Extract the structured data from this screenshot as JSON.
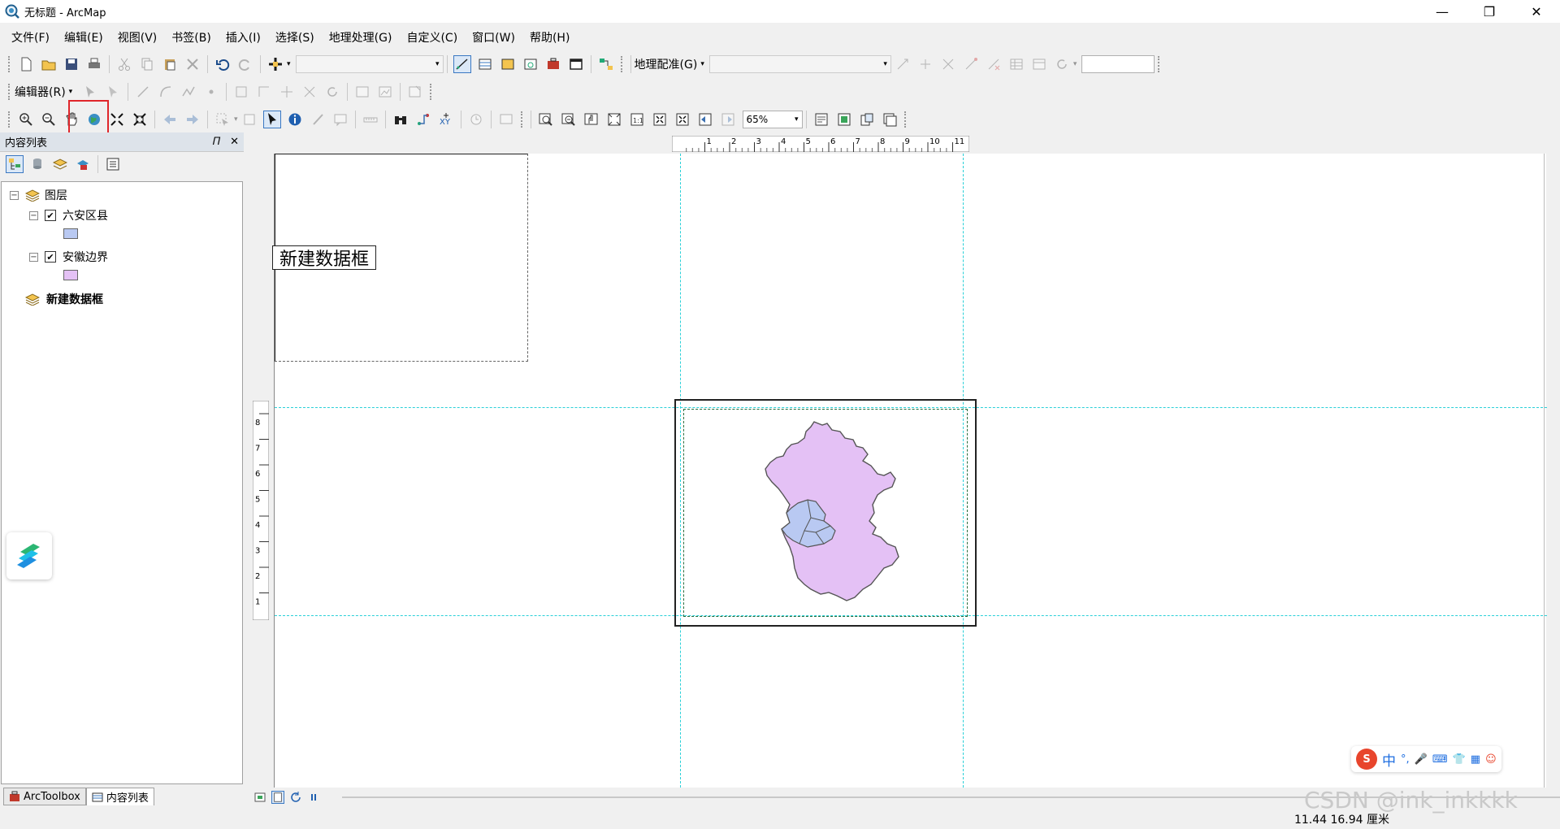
{
  "window": {
    "title": "无标题 - ArcMap",
    "controls": [
      "minimize",
      "restore",
      "close"
    ]
  },
  "menu": {
    "items": [
      "文件(F)",
      "编辑(E)",
      "视图(V)",
      "书签(B)",
      "插入(I)",
      "选择(S)",
      "地理处理(G)",
      "自定义(C)",
      "窗口(W)",
      "帮助(H)"
    ]
  },
  "toolbar1": {
    "georef_label": "地理配准(G)"
  },
  "toolbar2": {
    "editor_label": "编辑器(R)"
  },
  "toolbar3": {
    "zoom_value": "65%"
  },
  "toc": {
    "title": "内容列表",
    "root_layer_group": "图层",
    "layers": [
      {
        "name": "六安区县",
        "checked": true,
        "swatch_color": "#b9c9f2"
      },
      {
        "name": "安徽边界",
        "checked": true,
        "swatch_color": "#e4c1f5"
      }
    ],
    "second_data_frame": "新建数据框"
  },
  "bottom_tabs": [
    "ArcToolbox",
    "内容列表"
  ],
  "layout": {
    "data_frame_label": "新建数据框",
    "top_ruler_ticks": [
      "1",
      "2",
      "3",
      "4",
      "5",
      "6",
      "7",
      "8",
      "9",
      "10",
      "11"
    ],
    "left_ruler_ticks": [
      "8",
      "7",
      "6",
      "5",
      "4",
      "3",
      "2",
      "1"
    ]
  },
  "status": {
    "coords": "11.44  16.94 厘米"
  },
  "ime": {
    "label": "中"
  },
  "watermark": "CSDN @ink_inkkkk",
  "colors": {
    "anhui_fill": "#e4c1f5",
    "luan_fill": "#b9c9f2",
    "guide": "#2ad0d8",
    "highlight": "#e0262b"
  },
  "icons": [
    "zoom-in-icon",
    "zoom-out-icon",
    "pan-icon",
    "full-extent-globe-icon",
    "fixed-zoom-in-icon",
    "fixed-zoom-out-icon",
    "back-icon",
    "forward-icon",
    "select-elements-icon",
    "identify-icon",
    "find-icon",
    "go-to-xy-icon"
  ]
}
